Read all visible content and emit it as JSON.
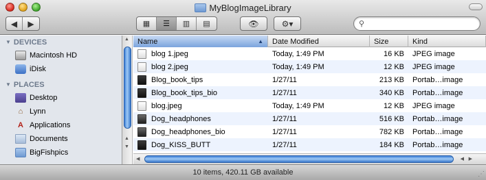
{
  "window": {
    "title": "MyBlogImageLibrary"
  },
  "toolbar": {
    "back_icon": "◀",
    "forward_icon": "▶",
    "view_icon_mode": "▦",
    "view_list_mode": "☰",
    "view_column_mode": "▥",
    "view_coverflow_mode": "▤",
    "quicklook_icon": "👁",
    "action_icon": "⚙▾",
    "search_placeholder": "",
    "search_value": ""
  },
  "sidebar": {
    "sections": [
      {
        "heading": "DEVICES",
        "items": [
          {
            "label": "Macintosh HD",
            "icon": "hard-drive-icon"
          },
          {
            "label": "iDisk",
            "icon": "idisk-icon"
          }
        ]
      },
      {
        "heading": "PLACES",
        "items": [
          {
            "label": "Desktop",
            "icon": "desktop-icon"
          },
          {
            "label": "Lynn",
            "icon": "home-icon"
          },
          {
            "label": "Applications",
            "icon": "applications-icon"
          },
          {
            "label": "Documents",
            "icon": "documents-icon"
          },
          {
            "label": "BigFishpics",
            "icon": "folder-icon"
          }
        ]
      }
    ]
  },
  "filelist": {
    "columns": {
      "name": "Name",
      "date": "Date Modified",
      "size": "Size",
      "kind": "Kind"
    },
    "sort_arrow": "▲",
    "rows": [
      {
        "name": "blog 1.jpeg",
        "date": "Today, 1:49 PM",
        "size": "16 KB",
        "kind": "JPEG image",
        "icon": "light"
      },
      {
        "name": "blog 2.jpeg",
        "date": "Today, 1:49 PM",
        "size": "12 KB",
        "kind": "JPEG image",
        "icon": "light"
      },
      {
        "name": "Blog_book_tips",
        "date": "1/27/11",
        "size": "213 KB",
        "kind": "Portab…image",
        "icon": "dark"
      },
      {
        "name": "Blog_book_tips_bio",
        "date": "1/27/11",
        "size": "340 KB",
        "kind": "Portab…image",
        "icon": "dark"
      },
      {
        "name": "blog.jpeg",
        "date": "Today, 1:49 PM",
        "size": "12 KB",
        "kind": "JPEG image",
        "icon": "light"
      },
      {
        "name": "Dog_headphones",
        "date": "1/27/11",
        "size": "516 KB",
        "kind": "Portab…image",
        "icon": "mid"
      },
      {
        "name": "Dog_headphones_bio",
        "date": "1/27/11",
        "size": "782 KB",
        "kind": "Portab…image",
        "icon": "mid"
      },
      {
        "name": "Dog_KISS_BUTT",
        "date": "1/27/11",
        "size": "184 KB",
        "kind": "Portab…image",
        "icon": "dark"
      }
    ]
  },
  "statusbar": {
    "text": "10 items, 420.11 GB available"
  }
}
